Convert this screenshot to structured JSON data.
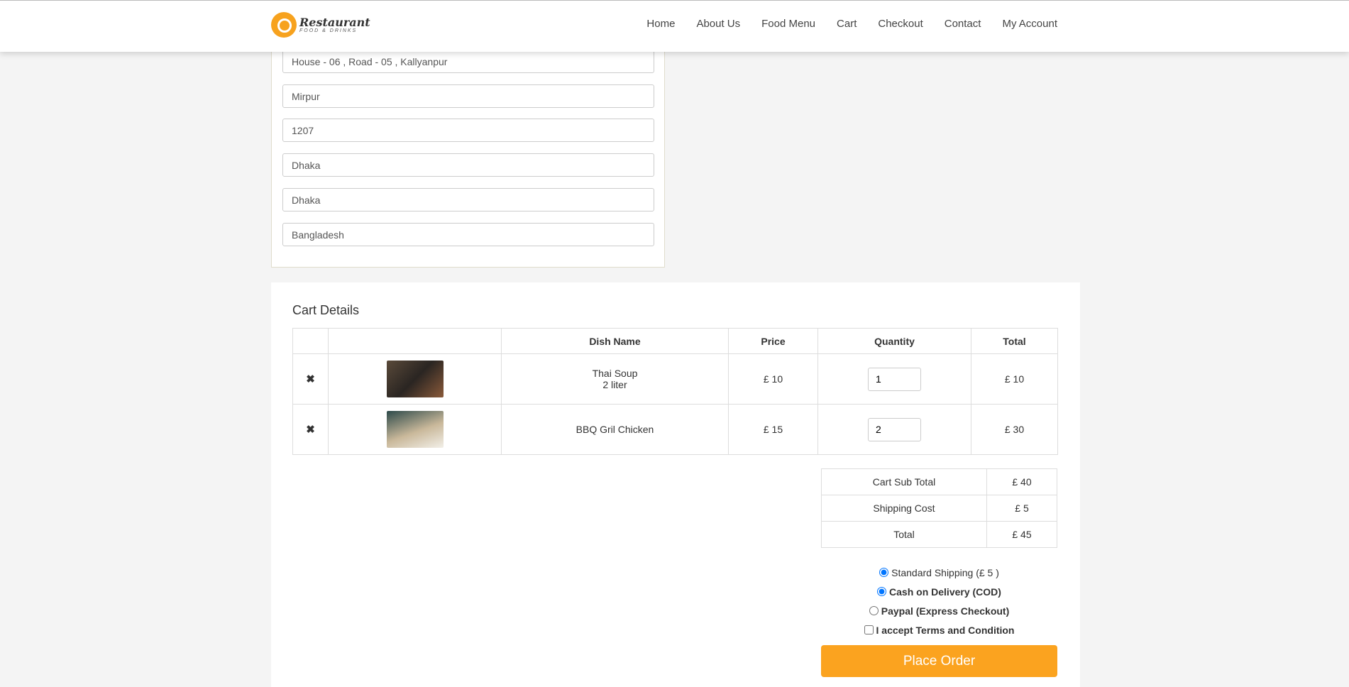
{
  "header": {
    "logo_title": "Restaurant",
    "logo_subtitle": "FOOD & DRINKS",
    "nav": [
      "Home",
      "About Us",
      "Food Menu",
      "Cart",
      "Checkout",
      "Contact",
      "My Account"
    ]
  },
  "address": {
    "fields": [
      "House - 06 , Road - 05 , Kallyanpur",
      "Mirpur",
      "1207",
      "Dhaka",
      "Dhaka",
      "Bangladesh"
    ]
  },
  "cart": {
    "title": "Cart Details",
    "columns": [
      "",
      "",
      "Dish Name",
      "Price",
      "Quantity",
      "Total"
    ],
    "items": [
      {
        "name": "Thai Soup",
        "variant": "2 liter",
        "price": "£ 10",
        "quantity": "1",
        "total": "£ 10"
      },
      {
        "name": "BBQ Gril Chicken",
        "variant": "",
        "price": "£ 15",
        "quantity": "2",
        "total": "£ 30"
      }
    ],
    "summary": [
      {
        "label": "Cart Sub Total",
        "value": "£ 40"
      },
      {
        "label": "Shipping Cost",
        "value": "£ 5"
      },
      {
        "label": "Total",
        "value": "£ 45"
      }
    ],
    "options": {
      "shipping": "Standard Shipping (£ 5 )",
      "cod": "Cash on Delivery (COD)",
      "paypal": "Paypal (Express Checkout)",
      "terms": "I accept Terms and Condition"
    },
    "place_order": "Place Order"
  },
  "colors": {
    "accent": "#fba31f"
  }
}
